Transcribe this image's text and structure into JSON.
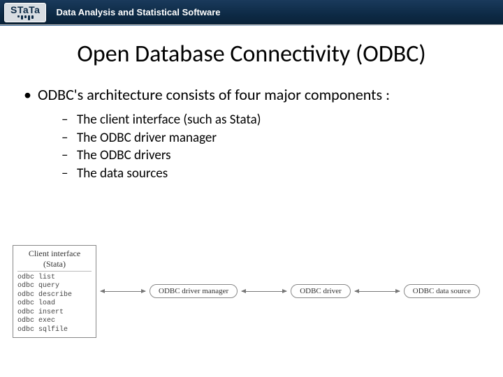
{
  "banner": {
    "logo_text": "STaTa",
    "tagline": "Data Analysis and Statistical Software"
  },
  "title": "Open Database Connectivity (ODBC)",
  "bullets": {
    "main": "ODBC's architecture consists of four major components :",
    "sub": [
      "The client interface (such as Stata)",
      "The ODBC driver manager",
      "The ODBC drivers",
      "The data sources"
    ]
  },
  "diagram": {
    "client_title_line1": "Client interface",
    "client_title_line2": "(Stata)",
    "client_commands": [
      "odbc list",
      "odbc query",
      "odbc describe",
      "odbc load",
      "odbc insert",
      "odbc exec",
      "odbc sqlfile"
    ],
    "node_manager": "ODBC driver manager",
    "node_driver": "ODBC driver",
    "node_source": "ODBC data source"
  }
}
